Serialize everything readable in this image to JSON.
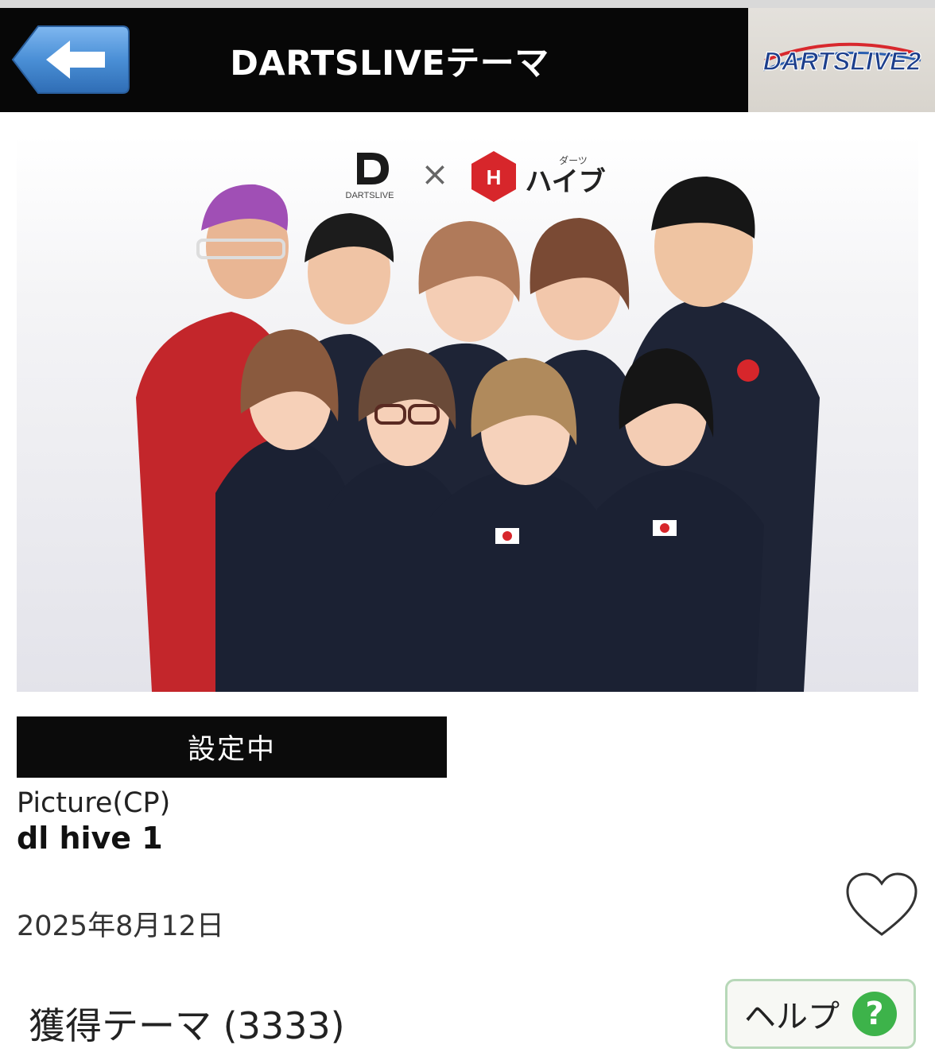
{
  "header": {
    "title": "DARTSLIVEテーマ",
    "back_icon": "arrow-left-icon",
    "brand_logo": "DARTSLIVE2"
  },
  "theme": {
    "collab_left": "DARTSLIVE",
    "collab_symbol": "×",
    "collab_right": "ハイブ",
    "collab_right_small": "ダーツ",
    "status": "設定中",
    "type": "Picture(CP)",
    "name": "dl hive 1",
    "date": "2025年8月12日",
    "favorite_icon": "heart-icon"
  },
  "footer": {
    "owned": "獲得テーマ (3333)",
    "help_label": "ヘルプ",
    "help_icon": "?"
  },
  "colors": {
    "header_bg": "#070707",
    "back_button": "#4a8fd6",
    "help_accent": "#3db34a",
    "hive_red": "#d7262b"
  }
}
